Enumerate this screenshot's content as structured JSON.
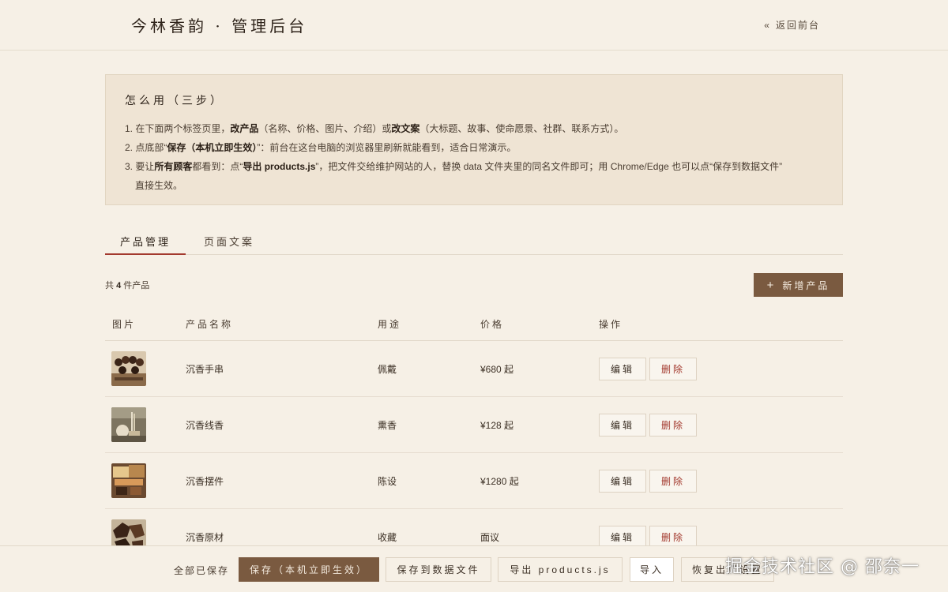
{
  "header": {
    "brand": "今林香韵 · 管理后台",
    "back_icon": "«",
    "back_label": "返回前台"
  },
  "guide": {
    "title": "怎么用（三步）",
    "step1": {
      "a": "1. 在下面两个标签页里，",
      "b1": "改产品",
      "c": "（名称、价格、图片、介绍）或",
      "b2": "改文案",
      "d": "（大标题、故事、使命愿景、社群、联系方式）。"
    },
    "step2": {
      "a": "2. 点底部“",
      "b": "保存（本机立即生效）",
      "c": "”：前台在这台电脑的浏览器里刷新就能看到，适合日常演示。"
    },
    "step3": {
      "a": "3. 要让",
      "b1": "所有顾客",
      "c": "都看到：点“",
      "b2": "导出 products.js",
      "d": "”，把文件交给维护网站的人，替换 data 文件夹里的同名文件即可；用 Chrome/Edge 也可以点“保存到数据文件”",
      "e": "直接生效。"
    }
  },
  "tabs": [
    {
      "label": "产品管理",
      "active": true
    },
    {
      "label": "页面文案",
      "active": false
    }
  ],
  "toolbar": {
    "count_prefix": "共",
    "count_value": "4",
    "count_suffix": "件产品",
    "add_icon": "+",
    "add_label": "新增产品"
  },
  "table": {
    "headers": [
      "图片",
      "产品名称",
      "用途",
      "价格",
      "操作"
    ],
    "rows": [
      {
        "name": "沉香手串",
        "use": "佩戴",
        "price": "¥680 起",
        "thumb_icon": "bracelet-thumbnail"
      },
      {
        "name": "沉香线香",
        "use": "熏香",
        "price": "¥128 起",
        "thumb_icon": "incense-thumbnail"
      },
      {
        "name": "沉香摆件",
        "use": "陈设",
        "price": "¥1280 起",
        "thumb_icon": "ornament-thumbnail"
      },
      {
        "name": "沉香原材",
        "use": "收藏",
        "price": "面议",
        "thumb_icon": "raw-wood-thumbnail"
      }
    ],
    "edit_label": "编辑",
    "delete_label": "删除"
  },
  "footer": {
    "status": "全部已保存",
    "save_label": "保存（本机立即生效）",
    "save_file_label": "保存到数据文件",
    "export_label": "导出 products.js",
    "import_label": "导入",
    "restore_label": "恢复出厂设置"
  },
  "watermark": "掘金技术社区 @ 邵奈一",
  "colors": {
    "background": "#f6f0e6",
    "accent": "#7a5a40",
    "danger": "#a3392e",
    "guide_bg": "#efe4d4"
  }
}
